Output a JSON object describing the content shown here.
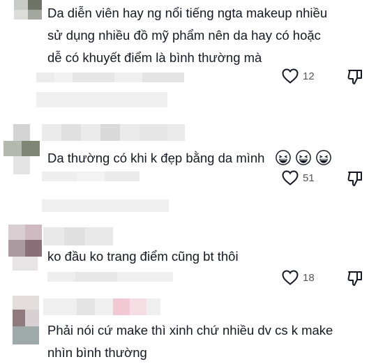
{
  "comments": [
    {
      "text_lines": [
        "Da diễn viên hay ng nổi tiếng ngta makeup nhiều",
        "sử dụng nhiều đồ mỹ phẩm nên da hay có hoặc",
        "dễ có khuyết điểm là bình thường mà"
      ],
      "likes": "12",
      "emoji_count": 0
    },
    {
      "text_lines": [
        "Da thường có khi k đẹp bằng da mình"
      ],
      "likes": "51",
      "emoji_count": 3,
      "emoji_icon": "laughing-tears-emoji"
    },
    {
      "text_lines": [
        "ko đầu ko trang điểm cũng bt thôi"
      ],
      "likes": "18",
      "emoji_count": 0
    },
    {
      "text_lines": [
        "Phải nói cứ make thì xinh chứ nhiều dv cs k make",
        "nhìn bình thường"
      ],
      "emoji_count": 0
    }
  ],
  "icons": {
    "like": "heart-outline-icon",
    "dislike": "thumbs-down-outline-icon"
  },
  "colors": {
    "text": "#161823",
    "icon": "#161823",
    "count": "#555555",
    "blur_gray": "#e3e3e3",
    "blur_pink": "#f2c9d2"
  }
}
